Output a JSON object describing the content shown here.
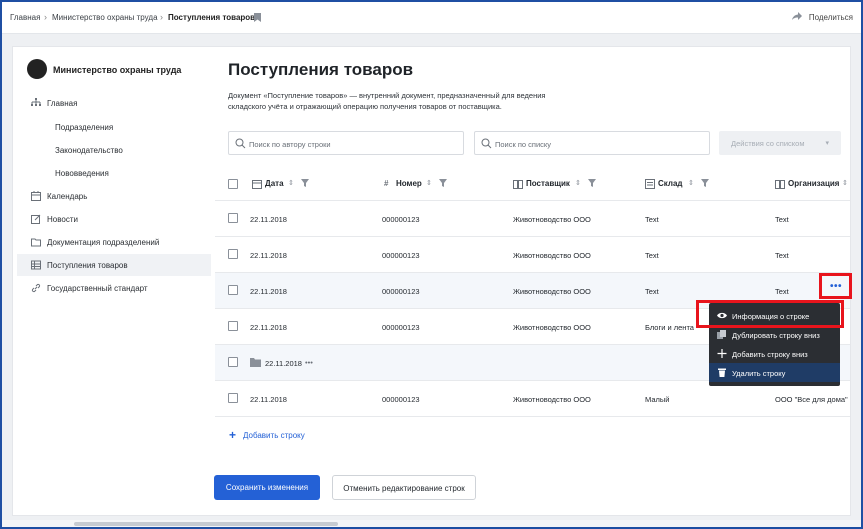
{
  "breadcrumb": {
    "items": [
      "Главная",
      "Министерство охраны труда",
      "Поступления товаров"
    ],
    "separator": "›"
  },
  "topbar": {
    "share_label": "Поделиться"
  },
  "sidebar": {
    "org_name": "Министерство охраны труда",
    "items": [
      {
        "label": "Главная",
        "icon": "hierarchy-icon"
      },
      {
        "label": "Подразделения"
      },
      {
        "label": "Законодательство"
      },
      {
        "label": "Нововведения"
      },
      {
        "label": "Календарь",
        "icon": "calendar-icon"
      },
      {
        "label": "Новости",
        "icon": "edit-icon"
      },
      {
        "label": "Документация подразделений",
        "icon": "folder-icon"
      },
      {
        "label": "Поступления товаров",
        "icon": "table-icon",
        "selected": true
      },
      {
        "label": "Государственный стандарт",
        "icon": "link-icon"
      }
    ]
  },
  "main": {
    "title": "Поступления товаров",
    "description": "Документ «Поступление товаров» — внутренний документ, предназначенный для ведения складского учёта и отражающий операцию получения товаров от поставщика.",
    "search_author_placeholder": "Поиск по автору строки",
    "search_list_placeholder": "Поиск по списку",
    "list_actions_label": "Действия со списком"
  },
  "table": {
    "columns": [
      "Дата",
      "Номер",
      "Поставщик",
      "Склад",
      "Организация"
    ],
    "rows": [
      {
        "date": "22.11.2018",
        "number": "000000123",
        "supplier": "Животноводство ООО",
        "warehouse": "Text",
        "org": "Text"
      },
      {
        "date": "22.11.2018",
        "number": "000000123",
        "supplier": "Животноводство ООО",
        "warehouse": "Text",
        "org": "Text"
      },
      {
        "date": "22.11.2018",
        "number": "000000123",
        "supplier": "Животноводство ООО",
        "warehouse": "Text",
        "org": "Text"
      },
      {
        "date": "22.11.2018",
        "number": "000000123",
        "supplier": "Животноводство ООО",
        "warehouse": "Блоги и лента",
        "org": ""
      },
      {
        "group_date": "22.11.2018",
        "group_more": "•••"
      },
      {
        "date": "22.11.2018",
        "number": "000000123",
        "supplier": "Животноводство ООО",
        "warehouse": "Малый",
        "org": "ООО \"Все для дома\""
      }
    ],
    "row_more": "•••",
    "add_row_label": "Добавить строку"
  },
  "context_menu": {
    "items": [
      {
        "label": "Информация о строке",
        "icon": "eye-icon"
      },
      {
        "label": "Дублировать строку вниз",
        "icon": "copy-icon"
      },
      {
        "label": "Добавить строку вниз",
        "icon": "plus-icon"
      },
      {
        "label": "Удалить строку",
        "icon": "trash-icon"
      }
    ]
  },
  "footer": {
    "save_label": "Сохранить изменения",
    "cancel_label": "Отменить редактирование строк"
  },
  "colors": {
    "accent": "#2461d6",
    "highlight": "#e8141c",
    "menu_bg": "#2b2e33"
  }
}
